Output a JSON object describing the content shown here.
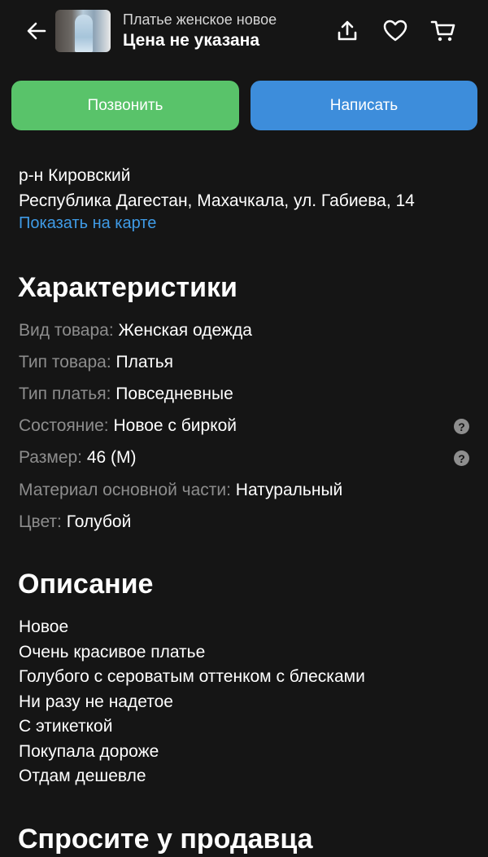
{
  "header": {
    "subtitle": "Платье женское новое",
    "price": "Цена не указана",
    "back_icon": "arrow-left-icon",
    "share_icon": "share-icon",
    "favorite_icon": "heart-icon",
    "cart_icon": "cart-icon"
  },
  "actions": {
    "call_label": "Позвонить",
    "write_label": "Написать",
    "call_color": "#59c36a",
    "write_color": "#3d8ddb"
  },
  "address": {
    "district": "р-н Кировский",
    "full": "Республика Дагестан, Махачкала, ул. Габиева, 14",
    "map_link": "Показать на карте"
  },
  "characteristics": {
    "title": "Характеристики",
    "items": [
      {
        "label": "Вид товара:",
        "value": "Женская одежда"
      },
      {
        "label": "Тип товара:",
        "value": "Платья"
      },
      {
        "label": "Тип платья:",
        "value": "Повседневные"
      },
      {
        "label": "Состояние:",
        "value": "Новое с биркой"
      },
      {
        "label": "Размер:",
        "value": "46 (M)"
      },
      {
        "label": "Материал основной части:",
        "value": "Натуральный"
      },
      {
        "label": "Цвет:",
        "value": "Голубой"
      }
    ]
  },
  "description": {
    "title": "Описание",
    "lines": [
      "Новое",
      "Очень красивое платье",
      "Голубого с сероватым оттенком с блесками",
      "Ни разу не надетое",
      "С этикеткой",
      "Покупала дороже",
      "Отдам дешевле"
    ]
  },
  "ask_seller": {
    "title": "Спросите у продавца"
  }
}
